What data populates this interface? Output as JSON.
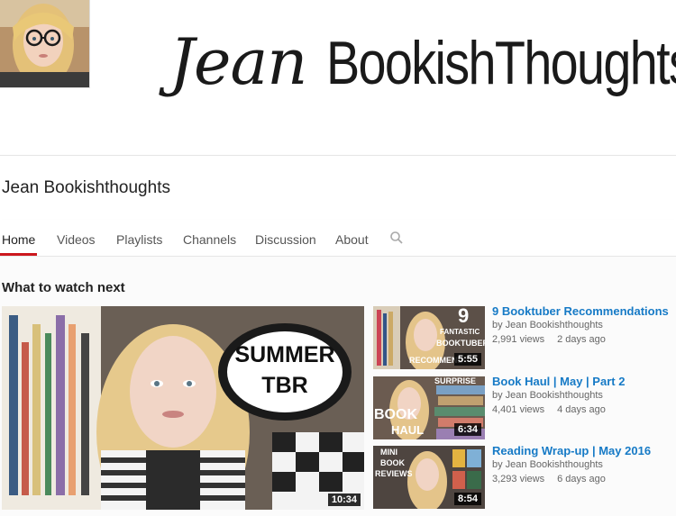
{
  "banner": {
    "script_text": "Jean",
    "block_text": "BookishThoughts"
  },
  "channel": {
    "name": "Jean Bookishthoughts"
  },
  "tabs": [
    {
      "label": "Home",
      "active": true
    },
    {
      "label": "Videos"
    },
    {
      "label": "Playlists"
    },
    {
      "label": "Channels"
    },
    {
      "label": "Discussion"
    },
    {
      "label": "About"
    }
  ],
  "section": {
    "title": "What to watch next"
  },
  "main_video": {
    "thumb_line1": "SUMMER",
    "thumb_line2": "TBR",
    "duration": "10:34"
  },
  "recommended": [
    {
      "title": "9 Booktuber Recommendations",
      "by": "by Jean Bookishthoughts",
      "views": "2,991 views",
      "age": "2 days ago",
      "duration": "5:55",
      "thumb_texts": [
        "9",
        "FANTASTIC",
        "BOOKTUBER",
        "RECOMMEND"
      ]
    },
    {
      "title": "Book Haul | May | Part 2",
      "by": "by Jean Bookishthoughts",
      "views": "4,401 views",
      "age": "4 days ago",
      "duration": "6:34",
      "thumb_texts": [
        "SURPRISE",
        "BOOK",
        "HAUL"
      ]
    },
    {
      "title": "Reading Wrap-up | May 2016",
      "by": "by Jean Bookishthoughts",
      "views": "3,293 views",
      "age": "6 days ago",
      "duration": "8:54",
      "thumb_texts": [
        "MINI",
        "BOOK",
        "REVIEWS"
      ]
    }
  ],
  "colors": {
    "accent_red": "#cc181e",
    "link_blue": "#167ac6"
  }
}
